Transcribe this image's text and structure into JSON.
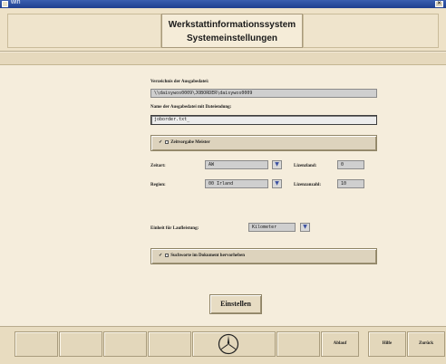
{
  "window": {
    "title": "win"
  },
  "header": {
    "line1": "Werkstattinformationssystem",
    "line2": "Systemeinstellungen"
  },
  "form": {
    "output_dir_label": "Verzeichnis der Ausgabedatei:",
    "output_dir_value": "\\\\daisywos0009\\JOBORDER\\daisywos0009",
    "filename_label": "Name der Ausgabedatei mit Dateiendung:",
    "filename_value": "joborder.txt_",
    "time_stamp_label": "Zeitvorgabe Meister",
    "time_unit_label": "Zeitart:",
    "time_unit_value": "AW",
    "license_country_label": "Lizenzland:",
    "license_country_value": "0",
    "region_label": "Region:",
    "region_value": "00 Irland",
    "license_count_label": "Lizenzanzahl:",
    "license_count_value": "10",
    "mileage_unit_label": "Einheit für Laufleistung:",
    "mileage_unit_value": "Kilometer",
    "highlight_label": "Suchworte im Dokument hervorheben",
    "submit_label": "Einstellen"
  },
  "footer": {
    "ablauf_label": "Ablauf",
    "hilfe_label": "Hilfe",
    "zurueck_label": "Zurück"
  },
  "colors": {
    "titlebar": "#2b4ea0",
    "background": "#f3ead8",
    "field": "#cfcfcf"
  },
  "icons": {
    "logo": "mercedes-star-icon",
    "check": "checkmark-icon",
    "dropdown": "chevron-down-icon"
  }
}
